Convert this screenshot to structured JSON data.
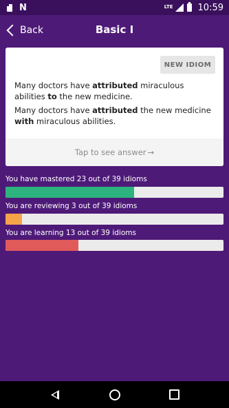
{
  "status_bar": {
    "network": "LTE",
    "time": "10:59",
    "icons": [
      "sd-card-icon",
      "n-notification-icon",
      "signal-icon",
      "battery-icon"
    ]
  },
  "app_bar": {
    "back_label": "Back",
    "title": "Basic I"
  },
  "card": {
    "new_idiom_label": "NEW IDIOM",
    "sentence1": {
      "before": "Many doctors have ",
      "bold1": "attributed",
      "mid": " miraculous abilities ",
      "bold2": "to",
      "after": " the new medicine."
    },
    "sentence2": {
      "before": "Many doctors have ",
      "bold1": "attributed",
      "mid": " the new medicine ",
      "bold2": "with",
      "after": " miraculous abilities."
    },
    "answer_label": "Tap to see answer",
    "answer_arrow": "→"
  },
  "progress": [
    {
      "label": "You have mastered 23 out of 39 idioms",
      "value": 23,
      "total": 39,
      "color": "#2db37d"
    },
    {
      "label": "You are reviewing 3 out of 39 idioms",
      "value": 3,
      "total": 39,
      "color": "#f5a44a"
    },
    {
      "label": "You are learning 13 out of 39 idioms",
      "value": 13,
      "total": 39,
      "color": "#e05a5a"
    }
  ],
  "colors": {
    "background": "#4e1a78",
    "status_bar": "#3a105d",
    "track": "#ebebeb"
  }
}
